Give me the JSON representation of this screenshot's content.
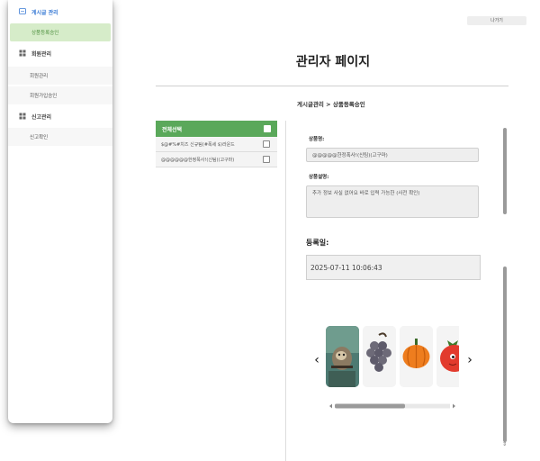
{
  "sidebar": {
    "sections": [
      {
        "label": "게시글 관리",
        "icon": "document-icon",
        "items": [
          {
            "label": "상품등록승인",
            "selected": true
          }
        ]
      },
      {
        "label": "회원관리",
        "icon": "grid-icon",
        "items": [
          {
            "label": "회원관리"
          },
          {
            "label": "회원가입승인"
          }
        ]
      },
      {
        "label": "신고관리",
        "icon": "grid-icon",
        "items": [
          {
            "label": "신고확인"
          }
        ]
      }
    ]
  },
  "header": {
    "logout_label": "나가기",
    "title": "관리자 페이지"
  },
  "breadcrumb": "게시글관리 > 상품등록승인",
  "product_list": {
    "select_all_label": "전체선택",
    "items": [
      {
        "label": "$@#%#치즈 신규팀(#폭세 $)라운드"
      },
      {
        "label": "@@@@@@한정폭사!(신팀)(고구마)"
      }
    ]
  },
  "detail": {
    "name_label": "상품명:",
    "name_value": "@@@@@한정폭사!(신팀)(고구마)",
    "desc_label": "상품설명:",
    "desc_value": "추가 정보 사실 없어요 바로 입력 가능한 (사전 확인)",
    "date_label": "등록일:",
    "date_value": "2025-07-11 10:06:43"
  },
  "carousel": {
    "prev_label": "‹",
    "next_label": "›",
    "images": [
      "sloth-image",
      "grape-image",
      "pumpkin-image",
      "tomato-image"
    ]
  },
  "colors": {
    "accent_green": "#5aa85a",
    "selected_bg": "#d6ecc9",
    "link_blue": "#3a7bd5"
  }
}
